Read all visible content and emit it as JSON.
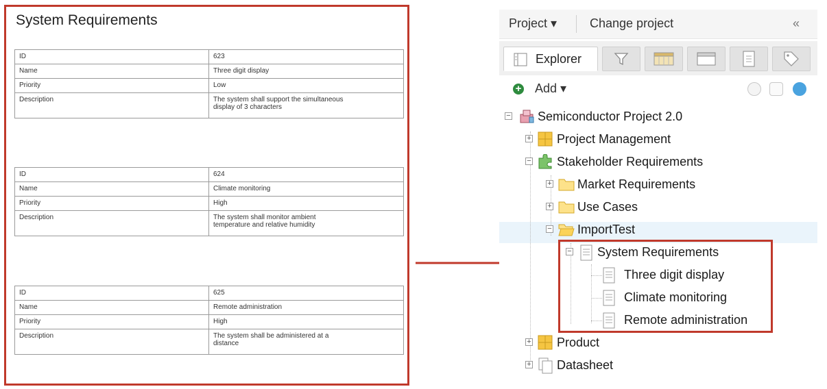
{
  "document": {
    "title": "System Requirements",
    "requirements": [
      {
        "id": "623",
        "name": "Three digit display",
        "priority": "Low",
        "description": [
          "The system shall support the simultaneous",
          "display of 3 characters"
        ]
      },
      {
        "id": "624",
        "name": "Climate monitoring",
        "priority": "High",
        "description": [
          "The system shall monitor ambient",
          "temperature and relative humidity"
        ]
      },
      {
        "id": "625",
        "name": "Remote administration",
        "priority": "High",
        "description": [
          "The system shall be administered at a",
          "distance"
        ]
      }
    ],
    "field_labels": {
      "id": "ID",
      "name": "Name",
      "priority": "Priority",
      "description": "Description"
    }
  },
  "explorer": {
    "topbar": {
      "project_menu": "Project ▾",
      "change_project": "Change project",
      "collapse": "«"
    },
    "tabs": [
      {
        "label": "Explorer",
        "icon": "explorer-icon"
      },
      {
        "icon": "filter-icon"
      },
      {
        "icon": "calendar-icon"
      },
      {
        "icon": "window-icon"
      },
      {
        "icon": "document-icon"
      },
      {
        "icon": "tag-icon"
      }
    ],
    "add_label": "Add ▾",
    "tree": {
      "root": "Semiconductor Project 2.0",
      "project_management": "Project Management",
      "stakeholder_requirements": "Stakeholder Requirements",
      "market_requirements": "Market Requirements",
      "use_cases": "Use Cases",
      "import_test": "ImportTest",
      "system_requirements": "System Requirements",
      "children": [
        "Three digit display",
        "Climate monitoring",
        "Remote administration"
      ],
      "product": "Product",
      "datasheet": "Datasheet"
    }
  },
  "colors": {
    "highlight_border": "#c0392b",
    "accent_green": "#2e8b3e",
    "folder_yellow": "#f5c542"
  }
}
